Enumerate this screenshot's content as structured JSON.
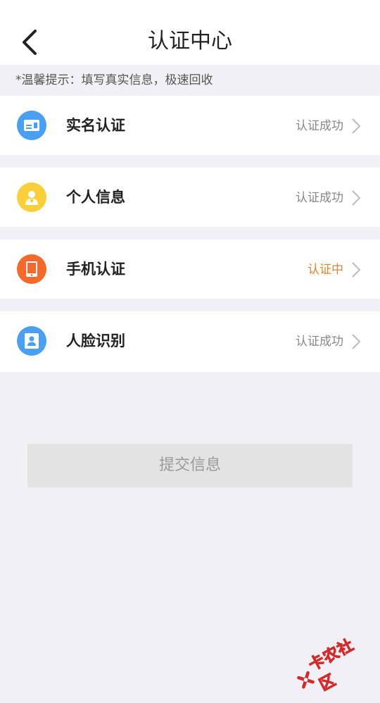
{
  "header": {
    "title": "认证中心"
  },
  "tip": "*温馨提示：填写真实信息，极速回收",
  "items": [
    {
      "label": "实名认证",
      "status": "认证成功",
      "icon": "id-card-icon",
      "icon_color": "#4a9ff0",
      "state": "success"
    },
    {
      "label": "个人信息",
      "status": "认证成功",
      "icon": "person-icon",
      "icon_color": "#fbcf3a",
      "state": "success"
    },
    {
      "label": "手机认证",
      "status": "认证中",
      "icon": "phone-icon",
      "icon_color": "#f46a2c",
      "state": "pending"
    },
    {
      "label": "人脸识别",
      "status": "认证成功",
      "icon": "face-scan-icon",
      "icon_color": "#4a9ff0",
      "state": "success"
    }
  ],
  "submit": {
    "label": "提交信息"
  },
  "watermark": {
    "text": "卡农社区",
    "color": "#d22b2b"
  },
  "colors": {
    "pending": "#e8822a",
    "background": "#f0f0f5"
  }
}
